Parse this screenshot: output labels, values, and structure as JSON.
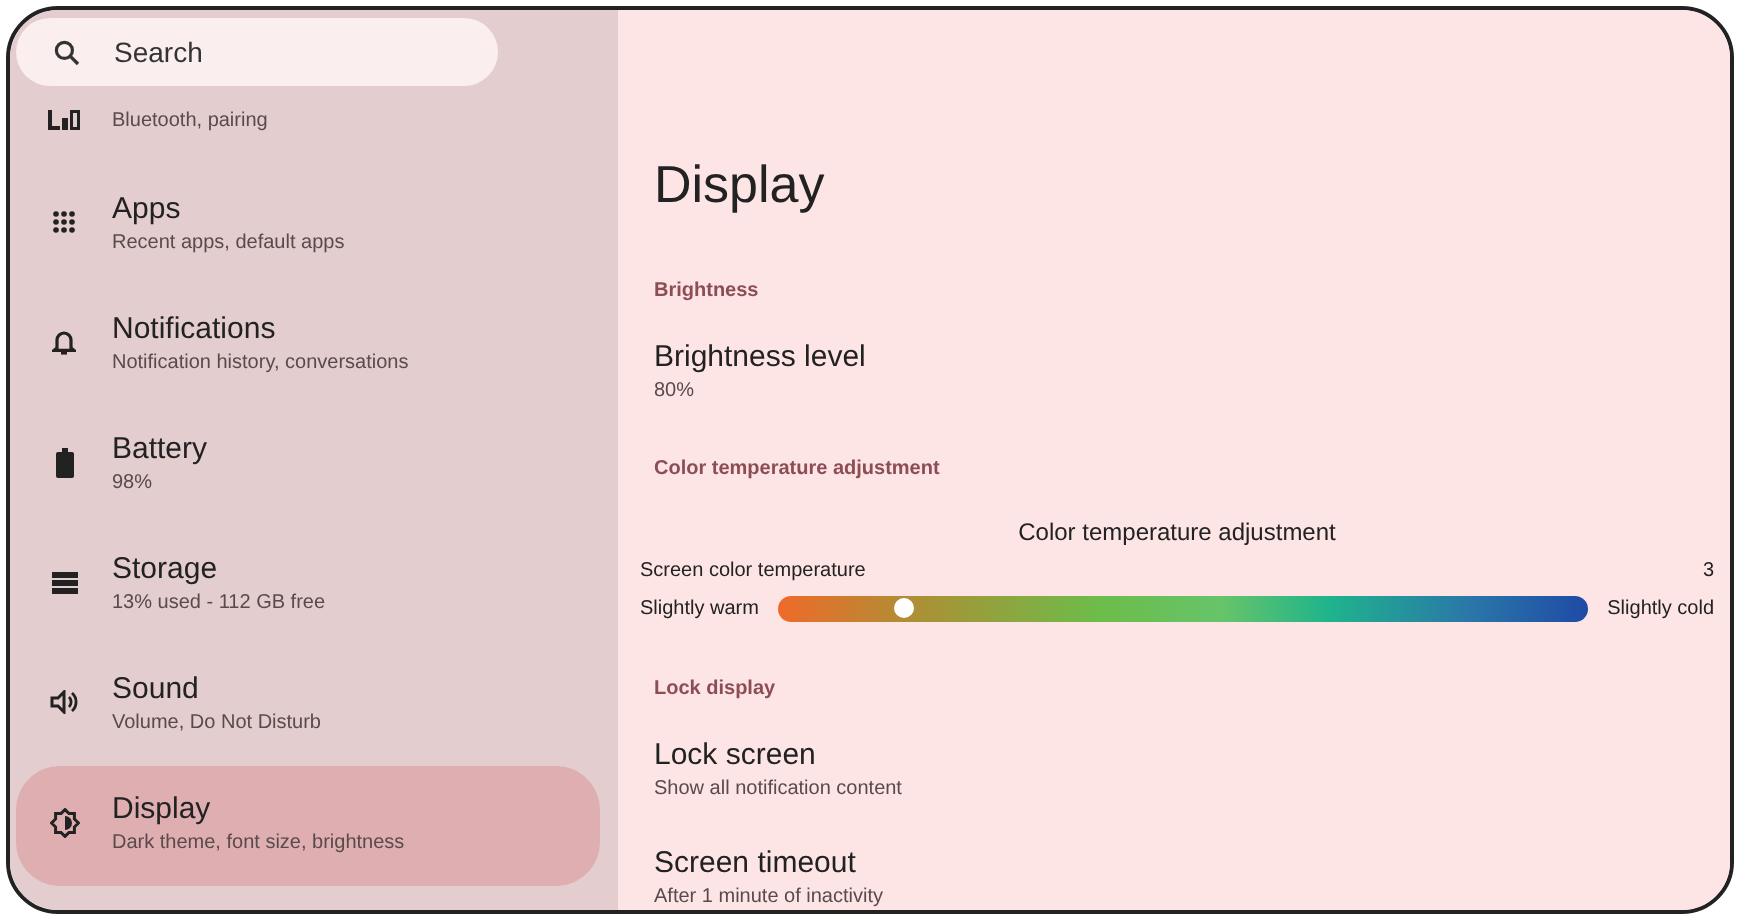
{
  "search": {
    "placeholder": "Search"
  },
  "sidebar": {
    "items": [
      {
        "kind": "devices",
        "subtitle": "Bluetooth, pairing",
        "selected": false
      },
      {
        "kind": "apps",
        "title": "Apps",
        "subtitle": "Recent apps, default apps",
        "selected": false
      },
      {
        "kind": "bell",
        "title": "Notifications",
        "subtitle": "Notification history, conversations",
        "selected": false
      },
      {
        "kind": "battery",
        "title": "Battery",
        "subtitle": "98%",
        "selected": false
      },
      {
        "kind": "storage",
        "title": "Storage",
        "subtitle": "13% used - 112 GB free",
        "selected": false
      },
      {
        "kind": "sound",
        "title": "Sound",
        "subtitle": "Volume, Do Not Disturb",
        "selected": false
      },
      {
        "kind": "display",
        "title": "Display",
        "subtitle": "Dark theme, font size, brightness",
        "selected": true
      }
    ]
  },
  "page": {
    "title": "Display",
    "sections": [
      {
        "header": "Brightness",
        "rows": [
          {
            "kind": "pref",
            "title": "Brightness level",
            "subtitle": "80%"
          }
        ]
      },
      {
        "header": "Color temperature adjustment",
        "rows": [
          {
            "kind": "slider",
            "title": "Color temperature adjustment",
            "label": "Screen color temperature",
            "reading": "3",
            "min_label": "Slightly warm",
            "max_label": "Slightly cold",
            "level": 0.155
          }
        ]
      },
      {
        "header": "Lock display",
        "rows": [
          {
            "kind": "pref",
            "title": "Lock screen",
            "subtitle": "Show all notification content"
          },
          {
            "kind": "pref",
            "title": "Screen timeout",
            "subtitle": "After 1 minute of inactivity"
          }
        ]
      }
    ]
  }
}
